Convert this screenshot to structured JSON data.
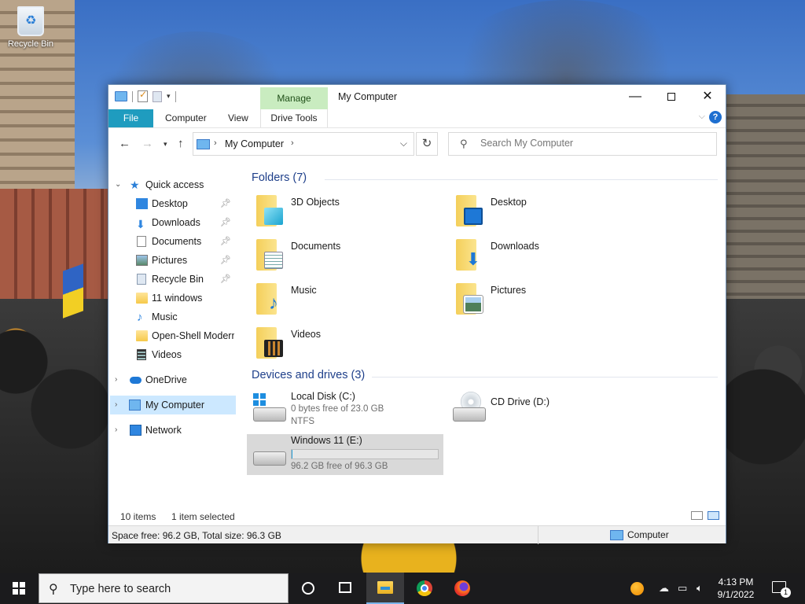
{
  "desktop": {
    "icons": [
      {
        "label": "Recycle Bin",
        "icon": "recycle-bin-icon"
      }
    ]
  },
  "window": {
    "title": "My Computer",
    "context_tab_group": "Manage",
    "ribbon_tabs": [
      "File",
      "Computer",
      "View",
      "Drive Tools"
    ],
    "address_path": "My Computer",
    "search_placeholder": "Search My Computer"
  },
  "sidebar": {
    "quick_access_label": "Quick access",
    "quick_access_items": [
      {
        "label": "Desktop",
        "icon": "desktop-icon",
        "pinned": true
      },
      {
        "label": "Downloads",
        "icon": "downloads-icon",
        "pinned": true
      },
      {
        "label": "Documents",
        "icon": "documents-icon",
        "pinned": true
      },
      {
        "label": "Pictures",
        "icon": "pictures-icon",
        "pinned": true
      },
      {
        "label": "Recycle Bin",
        "icon": "recycle-bin-icon",
        "pinned": true
      },
      {
        "label": "11 windows",
        "icon": "folder-icon",
        "pinned": false
      },
      {
        "label": "Music",
        "icon": "music-icon",
        "pinned": false
      },
      {
        "label": "Open-Shell Modern",
        "icon": "folder-icon",
        "pinned": false
      },
      {
        "label": "Videos",
        "icon": "videos-icon",
        "pinned": false
      }
    ],
    "roots": [
      {
        "label": "OneDrive",
        "icon": "onedrive-icon",
        "selected": false
      },
      {
        "label": "My Computer",
        "icon": "computer-icon",
        "selected": true
      },
      {
        "label": "Network",
        "icon": "network-icon",
        "selected": false
      }
    ]
  },
  "content": {
    "folders_header": "Folders (7)",
    "folders": [
      {
        "label": "3D Objects",
        "icon": "3d-objects-icon"
      },
      {
        "label": "Desktop",
        "icon": "desktop-folder-icon"
      },
      {
        "label": "Documents",
        "icon": "documents-folder-icon"
      },
      {
        "label": "Downloads",
        "icon": "downloads-folder-icon"
      },
      {
        "label": "Music",
        "icon": "music-folder-icon"
      },
      {
        "label": "Pictures",
        "icon": "pictures-folder-icon"
      },
      {
        "label": "Videos",
        "icon": "videos-folder-icon"
      }
    ],
    "drives_header": "Devices and drives (3)",
    "drives": [
      {
        "label": "Local Disk (C:)",
        "line1": "0 bytes free of 23.0 GB",
        "line2": "NTFS",
        "icon": "system-drive-icon"
      },
      {
        "label": "CD Drive (D:)",
        "icon": "cd-drive-icon"
      },
      {
        "label": "Windows 11 (E:)",
        "line1": "96.2 GB free of 96.3 GB",
        "used_fraction": 0.001,
        "icon": "hard-drive-icon",
        "selected": true
      }
    ]
  },
  "status": {
    "item_count": "10 items",
    "selection": "1 item selected",
    "details_left": "Space free: 96.2 GB, Total size: 96.3 GB",
    "details_right": "Computer"
  },
  "taskbar": {
    "search_placeholder": "Type here to search",
    "time": "4:13 PM",
    "date": "9/1/2022",
    "notification_count": "1"
  }
}
